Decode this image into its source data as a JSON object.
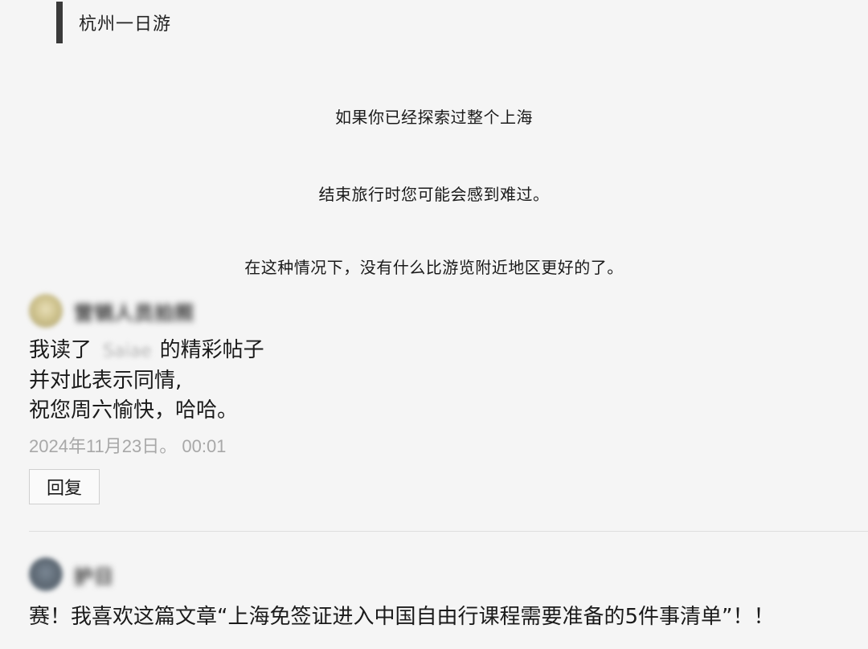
{
  "section": {
    "title": "杭州一日游"
  },
  "article": {
    "lines": [
      "如果你已经探索过整个上海",
      "结束旅行时您可能会感到难过。",
      "在这种情况下，没有什么比游览附近地区更好的了。"
    ]
  },
  "comments": [
    {
      "author": "营销人员拍照",
      "body_prefix": "我读了",
      "body_mention": "Saiae",
      "body_line1_suffix": "的精彩帖子",
      "body_line2": "并对此表示同情,",
      "body_line3": "祝您周六愉快，哈哈。",
      "timestamp": "2024年11月23日。 00:01",
      "reply_label": "回复"
    },
    {
      "author": "护日",
      "body": "赛！我喜欢这篇文章“上海免签证进入中国自由行课程需要准备的5件事清单”！！"
    }
  ],
  "icons": {
    "avatar_1": "avatar-icon",
    "avatar_2": "avatar-icon"
  },
  "colors": {
    "background": "#f5f5f5",
    "section_bar": "#3a3a3a",
    "timestamp": "#a8a8a8",
    "divider": "#dedede"
  }
}
